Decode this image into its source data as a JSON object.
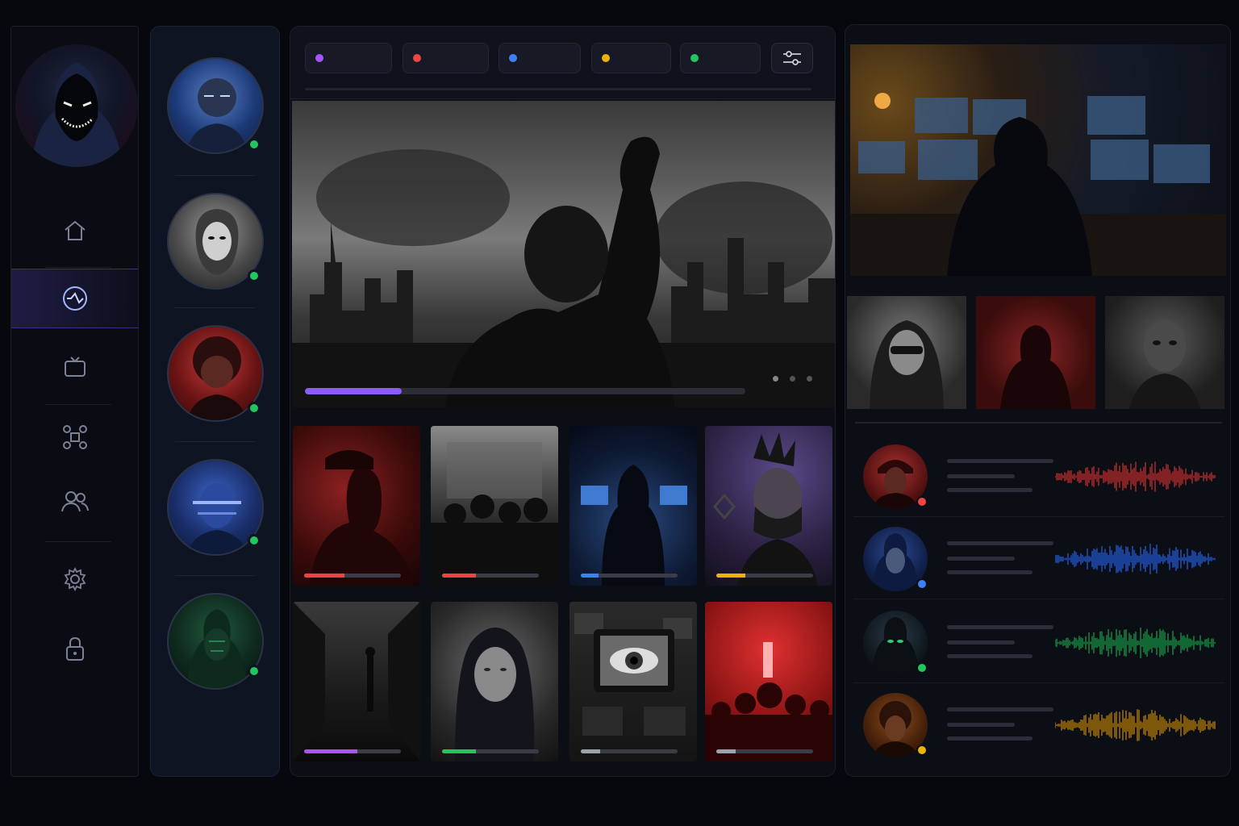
{
  "nav": {
    "items": [
      {
        "name": "home",
        "active": false
      },
      {
        "name": "network",
        "active": true
      },
      {
        "name": "tv",
        "active": false
      },
      {
        "name": "graph",
        "active": false
      },
      {
        "name": "people",
        "active": false
      },
      {
        "name": "settings",
        "active": false
      },
      {
        "name": "lock",
        "active": false
      }
    ],
    "accent": "#7c6cff"
  },
  "contacts": [
    {
      "status_color": "#22c55e",
      "tint": "#1e4a8a"
    },
    {
      "status_color": "#22c55e",
      "tint": "#5a5a5a"
    },
    {
      "status_color": "#22c55e",
      "tint": "#8a2020"
    },
    {
      "status_color": "#22c55e",
      "tint": "#233f8f"
    },
    {
      "status_color": "#22c55e",
      "tint": "#1d4a35"
    }
  ],
  "filters": [
    {
      "color": "#a855f7",
      "label": ""
    },
    {
      "color": "#ef4444",
      "label": ""
    },
    {
      "color": "#3b82f6",
      "label": ""
    },
    {
      "color": "#eab308",
      "label": ""
    },
    {
      "color": "#22c55e",
      "label": ""
    }
  ],
  "hero": {
    "progress": 0.22,
    "progress_color": "#8b5cf6",
    "pager_count": 3
  },
  "tiles": [
    {
      "theme": "red",
      "progress": 0.42,
      "color": "#ef4444"
    },
    {
      "theme": "grey",
      "progress": 0.35,
      "color": "#ef4444"
    },
    {
      "theme": "blue",
      "progress": 0.18,
      "color": "#3b82f6"
    },
    {
      "theme": "purple",
      "progress": 0.3,
      "color": "#eab308"
    },
    {
      "theme": "grey-dark",
      "progress": 0.55,
      "color": "#a855f7"
    },
    {
      "theme": "grey",
      "progress": 0.35,
      "color": "#22c55e"
    },
    {
      "theme": "grey-dark",
      "progress": 0.2,
      "color": "#9ca3af"
    },
    {
      "theme": "red-bright",
      "progress": 0.2,
      "color": "#9ca3af"
    }
  ],
  "voices": [
    {
      "color": "#ef4444",
      "wave_color": "#d32f2f"
    },
    {
      "color": "#3b82f6",
      "wave_color": "#2563eb"
    },
    {
      "color": "#22c55e",
      "wave_color": "#16a34a"
    },
    {
      "color": "#eab308",
      "wave_color": "#ca8a04"
    }
  ]
}
